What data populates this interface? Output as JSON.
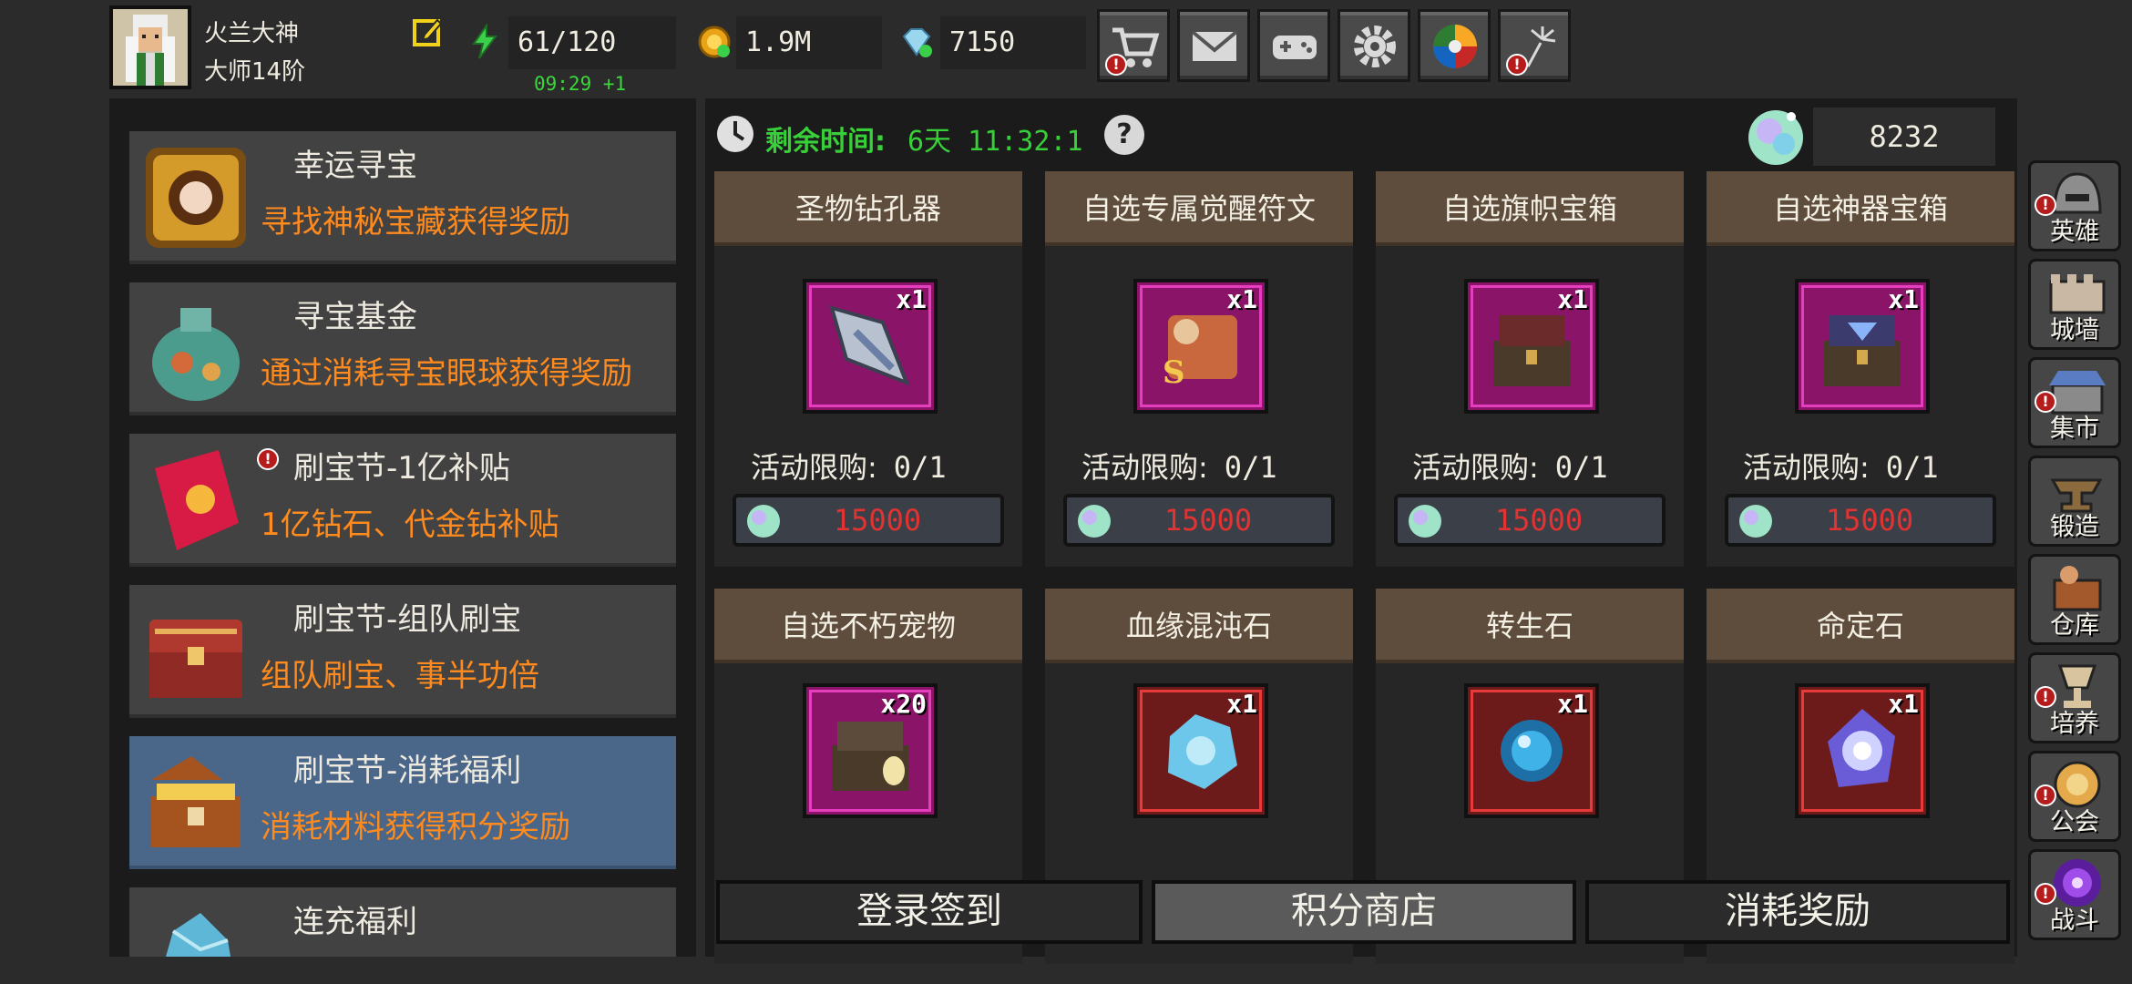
{
  "player": {
    "name": "火兰大神",
    "rank": "大师14阶"
  },
  "resources": {
    "energy": "61/120",
    "energy_timer": "09:29 +1",
    "gold": "1.9M",
    "gems": "7150"
  },
  "top_buttons": [
    {
      "name": "shop",
      "icon": "cart-icon",
      "alert": true
    },
    {
      "name": "mail",
      "icon": "mail-icon",
      "alert": false
    },
    {
      "name": "gamepad",
      "icon": "gamepad-icon",
      "alert": false
    },
    {
      "name": "settings",
      "icon": "gear-icon",
      "alert": false
    },
    {
      "name": "wheel",
      "icon": "color-wheel-icon",
      "alert": false
    },
    {
      "name": "fireworks",
      "icon": "fireworks-icon",
      "alert": true
    }
  ],
  "events": [
    {
      "title": "幸运寻宝",
      "desc": "寻找神秘宝藏获得奖励",
      "alert": false
    },
    {
      "title": "寻宝基金",
      "desc": "通过消耗寻宝眼球获得奖励",
      "alert": false
    },
    {
      "title": "刷宝节-1亿补贴",
      "desc": "1亿钻石、代金钻补贴",
      "alert": true
    },
    {
      "title": "刷宝节-组队刷宝",
      "desc": "组队刷宝、事半功倍",
      "alert": false
    },
    {
      "title": "刷宝节-消耗福利",
      "desc": "消耗材料获得积分奖励",
      "alert": false,
      "active": true
    },
    {
      "title": "连充福利",
      "desc": "",
      "alert": false
    }
  ],
  "main": {
    "remaining_label": "剩余时间:",
    "remaining_value": "6天 11:32:1",
    "help": "?",
    "gem_balance": "8232"
  },
  "items": [
    {
      "name": "圣物钻孔器",
      "qty": "x1",
      "limit_label": "活动限购:",
      "limit": "0/1",
      "price": "15000"
    },
    {
      "name": "自选专属觉醒符文",
      "qty": "x1",
      "limit_label": "活动限购:",
      "limit": "0/1",
      "price": "15000"
    },
    {
      "name": "自选旗帜宝箱",
      "qty": "x1",
      "limit_label": "活动限购:",
      "limit": "0/1",
      "price": "15000"
    },
    {
      "name": "自选神器宝箱",
      "qty": "x1",
      "limit_label": "活动限购:",
      "limit": "0/1",
      "price": "15000"
    },
    {
      "name": "自选不朽宠物",
      "qty": "x20"
    },
    {
      "name": "血缘混沌石",
      "qty": "x1"
    },
    {
      "name": "转生石",
      "qty": "x1"
    },
    {
      "name": "命定石",
      "qty": "x1"
    }
  ],
  "tabs": [
    {
      "label": "登录签到",
      "active": false
    },
    {
      "label": "积分商店",
      "active": true
    },
    {
      "label": "消耗奖励",
      "active": false
    }
  ],
  "nav": [
    {
      "label": "英雄",
      "alert": true
    },
    {
      "label": "城墙",
      "alert": false
    },
    {
      "label": "集市",
      "alert": true
    },
    {
      "label": "锻造",
      "alert": false
    },
    {
      "label": "仓库",
      "alert": false
    },
    {
      "label": "培养",
      "alert": true
    },
    {
      "label": "公会",
      "alert": true
    },
    {
      "label": "战斗",
      "alert": true
    }
  ],
  "colors": {
    "accent_orange": "#ff8a1d",
    "timer_green": "#38d038",
    "price_red": "#e23232",
    "active_card": "#4a6789",
    "item_frame_purple": "#8a1467"
  }
}
